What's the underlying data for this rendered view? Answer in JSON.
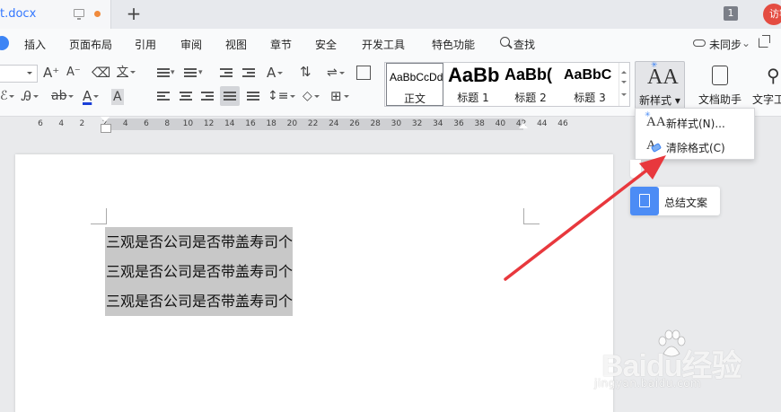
{
  "tabbar": {
    "filename": "t.docx",
    "new_tab": "+",
    "page_count": "1",
    "visitor": "访客"
  },
  "menu": {
    "items": [
      "插入",
      "页面布局",
      "引用",
      "审阅",
      "视图",
      "章节",
      "安全",
      "开发工具",
      "特色功能"
    ],
    "search": "查找",
    "sync": "未同步"
  },
  "ribbon": {
    "font_grow": "A⁺",
    "font_shrink": "A⁻",
    "phonetic": "文",
    "style_gallery": [
      {
        "sample": "AaBbCcDd",
        "name": "正文"
      },
      {
        "sample": "AaBb",
        "name": "标题 1"
      },
      {
        "sample": "AaBb(",
        "name": "标题 2"
      },
      {
        "sample": "AaBbC",
        "name": "标题 3"
      }
    ],
    "new_style": "新样式",
    "doc_assistant": "文档助手",
    "text_tool": "文字工"
  },
  "ruler": {
    "ticks": [
      "6",
      "4",
      "2",
      "2",
      "4",
      "6",
      "8",
      "10",
      "12",
      "14",
      "16",
      "18",
      "20",
      "22",
      "24",
      "26",
      "28",
      "30",
      "32",
      "34",
      "36",
      "38",
      "40",
      "42",
      "44",
      "46"
    ]
  },
  "document": {
    "lines": [
      "三观是否公司是否带盖寿司个",
      "三观是否公司是否带盖寿司个",
      "三观是否公司是否带盖寿司个"
    ]
  },
  "dropdown": {
    "items": [
      {
        "label": "新样式(N)...",
        "icon": "new-style-icon"
      },
      {
        "label": "清除格式(C)",
        "icon": "clear-format-icon"
      }
    ]
  },
  "floating": {
    "summary": "总结文案"
  },
  "watermark": {
    "brand": "Baidu经验",
    "url": "jingyan.baidu.com"
  },
  "colors": {
    "accent": "#3d84f5",
    "arrow": "#e8383d",
    "selection": "#c8c8c8"
  }
}
